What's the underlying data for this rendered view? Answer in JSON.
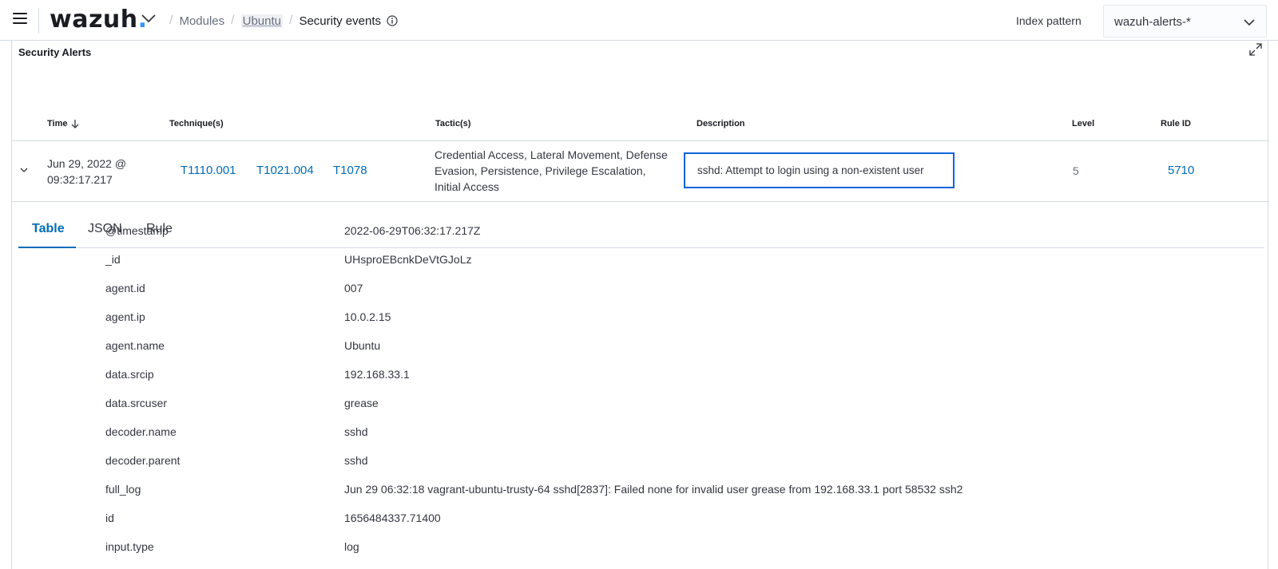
{
  "topbar": {
    "logo_text": "wazuh",
    "logo_dot": ".",
    "breadcrumbs": {
      "modules": "Modules",
      "agent": "Ubuntu",
      "current": "Security events"
    },
    "index_pattern_label": "Index pattern",
    "index_pattern_value": "wazuh-alerts-*",
    "icons": [
      "menu-icon",
      "chevron-down-icon",
      "info-icon"
    ]
  },
  "panel": {
    "title": "Security Alerts",
    "columns": {
      "time": "Time",
      "techniques": "Technique(s)",
      "tactics": "Tactic(s)",
      "description": "Description",
      "level": "Level",
      "rule_id": "Rule ID"
    },
    "row": {
      "time_line1": "Jun 29, 2022 @",
      "time_line2": "09:32:17.217",
      "techniques": [
        "T1110.001",
        "T1021.004",
        "T1078"
      ],
      "tactics": "Credential Access, Lateral Movement, Defense Evasion, Persistence, Privilege Escalation, Initial Access",
      "description": "sshd: Attempt to login using a non-existent user",
      "level": "5",
      "rule_id": "5710"
    }
  },
  "tabs": [
    "Table",
    "JSON",
    "Rule"
  ],
  "active_tab": "Table",
  "details": [
    {
      "key": "@timestamp",
      "value": "2022-06-29T06:32:17.217Z"
    },
    {
      "key": "_id",
      "value": "UHsproEBcnkDeVtGJoLz"
    },
    {
      "key": "agent.id",
      "value": "007"
    },
    {
      "key": "agent.ip",
      "value": "10.0.2.15"
    },
    {
      "key": "agent.name",
      "value": "Ubuntu"
    },
    {
      "key": "data.srcip",
      "value": "192.168.33.1"
    },
    {
      "key": "data.srcuser",
      "value": "grease"
    },
    {
      "key": "decoder.name",
      "value": "sshd"
    },
    {
      "key": "decoder.parent",
      "value": "sshd"
    },
    {
      "key": "full_log",
      "value": "Jun 29 06:32:18 vagrant-ubuntu-trusty-64 sshd[2837]: Failed none for invalid user grease from 192.168.33.1 port 58532 ssh2"
    },
    {
      "key": "id",
      "value": "1656484337.71400"
    },
    {
      "key": "input.type",
      "value": "log"
    }
  ],
  "colors": {
    "link": "#006bb8",
    "logo_dot": "#3595f9",
    "focus_border": "#0b64dd",
    "border": "#d3dae6"
  }
}
